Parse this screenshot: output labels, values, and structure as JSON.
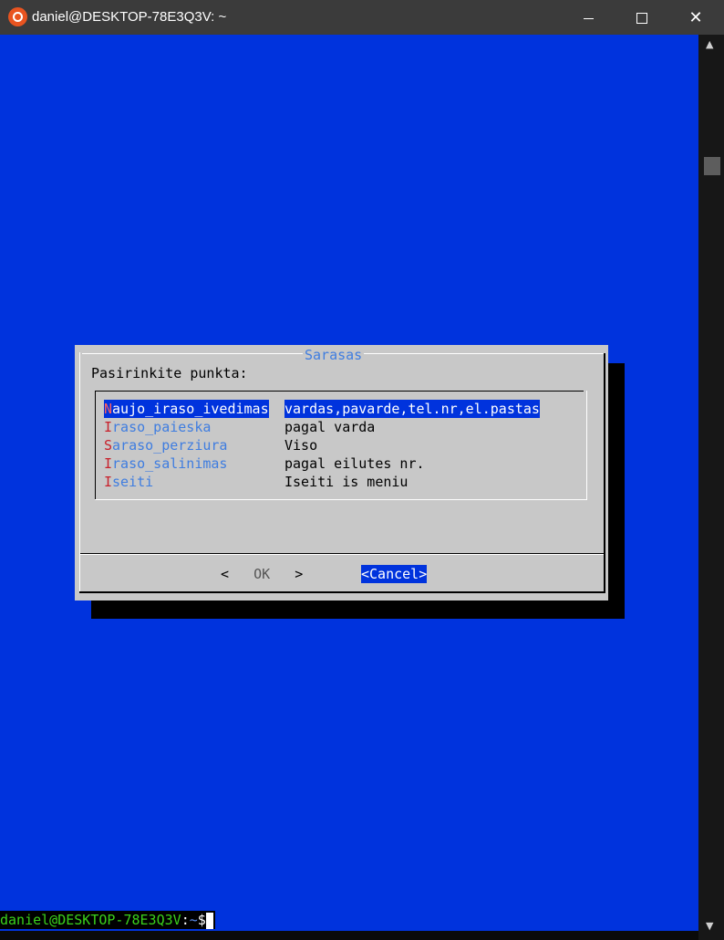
{
  "window": {
    "title": "daniel@DESKTOP-78E3Q3V: ~",
    "app_icon": "ubuntu-icon",
    "controls": [
      "minimize",
      "maximize",
      "close"
    ]
  },
  "dialog": {
    "title": "Sarasas",
    "prompt": "Pasirinkite punkta:",
    "menu": [
      {
        "hot": "N",
        "rest": "aujo_iraso_ivedimas",
        "desc": "vardas,pavarde,tel.nr,el.pastas",
        "selected": true
      },
      {
        "hot": "I",
        "rest": "raso_paieska",
        "desc": "pagal varda",
        "selected": false
      },
      {
        "hot": "S",
        "rest": "araso_perziura",
        "desc": "Viso",
        "selected": false
      },
      {
        "hot": "I",
        "rest": "raso_salinimas",
        "desc": "pagal eilutes nr.",
        "selected": false
      },
      {
        "hot": "I",
        "rest": "seiti",
        "desc": "Iseiti is meniu",
        "selected": false
      }
    ],
    "buttons": {
      "ok_left": "<",
      "ok_label": "OK",
      "ok_right": ">",
      "cancel_label": "<Cancel>"
    }
  },
  "shell": {
    "user_host": "daniel@DESKTOP-78E3Q3V",
    "colon": ":",
    "path": "~",
    "symbol": "$"
  },
  "colors": {
    "terminal_bg": "#0033dd",
    "dialog_bg": "#c8c8c8",
    "title_accent": "#3f7de0",
    "hotkey": "#c8202a"
  }
}
